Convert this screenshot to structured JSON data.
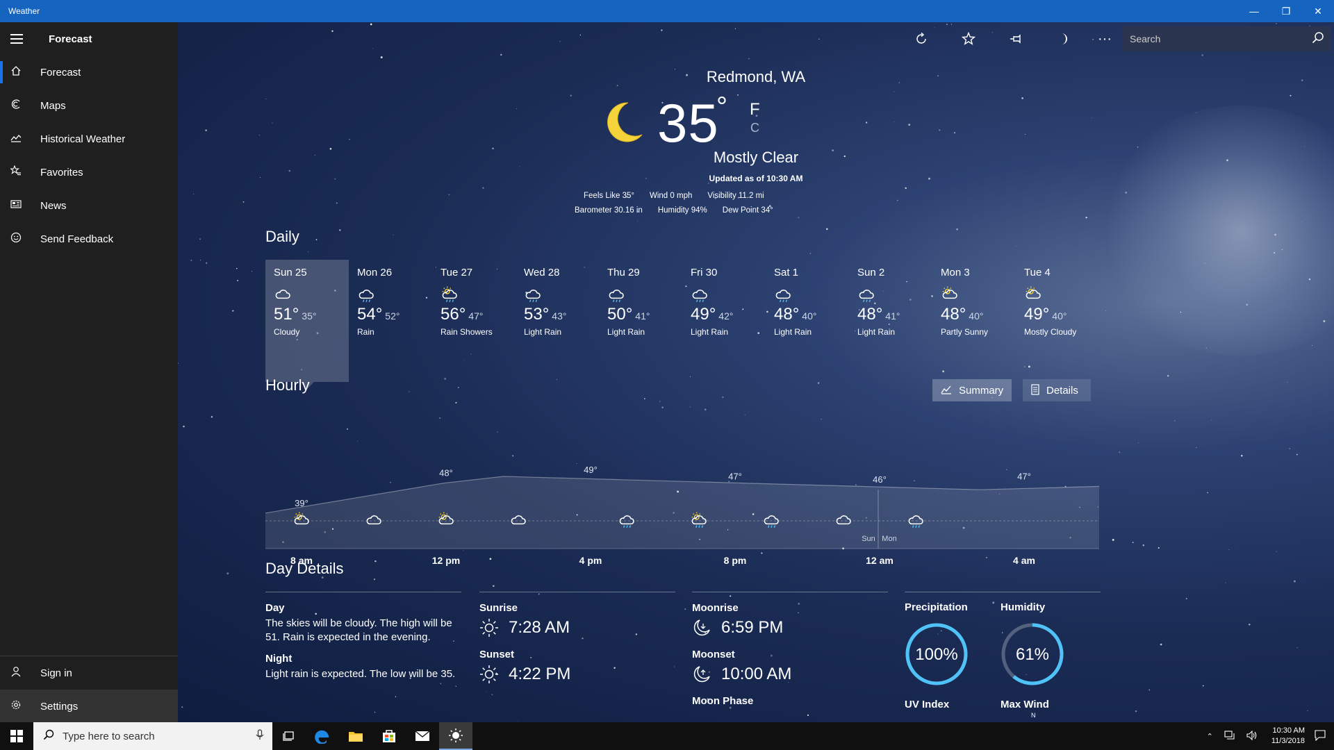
{
  "window": {
    "title": "Weather"
  },
  "sidebar": {
    "title": "Forecast",
    "items": [
      {
        "label": "Forecast",
        "icon": "home-icon"
      },
      {
        "label": "Maps",
        "icon": "maps-icon"
      },
      {
        "label": "Historical Weather",
        "icon": "chart-icon"
      },
      {
        "label": "Favorites",
        "icon": "star-list-icon"
      },
      {
        "label": "News",
        "icon": "news-icon"
      },
      {
        "label": "Send Feedback",
        "icon": "smiley-icon"
      }
    ],
    "bottom": [
      {
        "label": "Sign in",
        "icon": "person-icon"
      },
      {
        "label": "Settings",
        "icon": "gear-icon"
      }
    ]
  },
  "search": {
    "placeholder": "Search"
  },
  "current": {
    "location": "Redmond, WA",
    "temp": "35",
    "deg": "°",
    "unit_f": "F",
    "unit_c": "C",
    "condition": "Mostly Clear",
    "updated": "Updated as of 10:30 AM",
    "feels_like": "Feels Like  35°",
    "wind": "Wind   0 mph",
    "visibility": "Visibility  11.2 mi",
    "barometer": "Barometer  30.16 in",
    "humidity": "Humidity  94%",
    "dew_point": "Dew Point  34°"
  },
  "daily_title": "Daily",
  "daily": [
    {
      "name": "Sun 25",
      "hi": "51°",
      "lo": "35°",
      "cond": "Cloudy",
      "icon": "cloud"
    },
    {
      "name": "Mon 26",
      "hi": "54°",
      "lo": "52°",
      "cond": "Rain",
      "icon": "rain"
    },
    {
      "name": "Tue 27",
      "hi": "56°",
      "lo": "47°",
      "cond": "Rain Showers",
      "icon": "sunrain"
    },
    {
      "name": "Wed 28",
      "hi": "53°",
      "lo": "43°",
      "cond": "Light Rain",
      "icon": "rain"
    },
    {
      "name": "Thu 29",
      "hi": "50°",
      "lo": "41°",
      "cond": "Light Rain",
      "icon": "rain"
    },
    {
      "name": "Fri 30",
      "hi": "49°",
      "lo": "42°",
      "cond": "Light Rain",
      "icon": "rain"
    },
    {
      "name": "Sat 1",
      "hi": "48°",
      "lo": "40°",
      "cond": "Light Rain",
      "icon": "rain"
    },
    {
      "name": "Sun 2",
      "hi": "48°",
      "lo": "41°",
      "cond": "Light Rain",
      "icon": "rain"
    },
    {
      "name": "Mon 3",
      "hi": "48°",
      "lo": "40°",
      "cond": "Partly Sunny",
      "icon": "suncloud"
    },
    {
      "name": "Tue 4",
      "hi": "49°",
      "lo": "40°",
      "cond": "Mostly Cloudy",
      "icon": "suncloud"
    }
  ],
  "hourly": {
    "title": "Hourly",
    "summary_label": "Summary",
    "details_label": "Details",
    "temp_labels": [
      "39°",
      "48°",
      "49°",
      "47°",
      "46°",
      "47°"
    ],
    "time_labels": [
      "8 am",
      "12 pm",
      "4 pm",
      "8 pm",
      "12 am",
      "4 am"
    ],
    "day_split_left": "Sun",
    "day_split_right": "Mon",
    "chart_points": [
      39,
      42,
      45,
      48,
      50,
      49.5,
      49,
      48.5,
      48,
      47.5,
      47,
      46.5,
      46,
      46.5,
      47
    ],
    "icons": [
      "suncloud",
      "cloud",
      "suncloud",
      "cloud",
      "rain",
      "sunrain",
      "rain",
      "cloud",
      "rain"
    ]
  },
  "day_details": {
    "title": "Day Details",
    "day_head": "Day",
    "day_text": "The skies will be cloudy. The high will be 51. Rain is expected in the evening.",
    "night_head": "Night",
    "night_text": "Light rain is expected. The low will be 35.",
    "sunrise_head": "Sunrise",
    "sunrise": "7:28 AM",
    "sunset_head": "Sunset",
    "sunset": "4:22 PM",
    "moonrise_head": "Moonrise",
    "moonrise": "6:59 PM",
    "moonset_head": "Moonset",
    "moonset": "10:00 AM",
    "moonphase_head": "Moon Phase",
    "precip_head": "Precipitation",
    "precip": "100%",
    "precip_fraction": 1.0,
    "humidity_head": "Humidity",
    "humidity": "61%",
    "humidity_fraction": 0.61,
    "uv_head": "UV Index",
    "maxwind_head": "Max Wind",
    "maxwind_dir": "N"
  },
  "taskbar": {
    "search_placeholder": "Type here to search",
    "time": "10:30 AM",
    "date": "11/3/2018"
  },
  "colors": {
    "accent": "#1565c0",
    "ring": "#4fc3f7",
    "sidebar": "#1f1f1f"
  }
}
